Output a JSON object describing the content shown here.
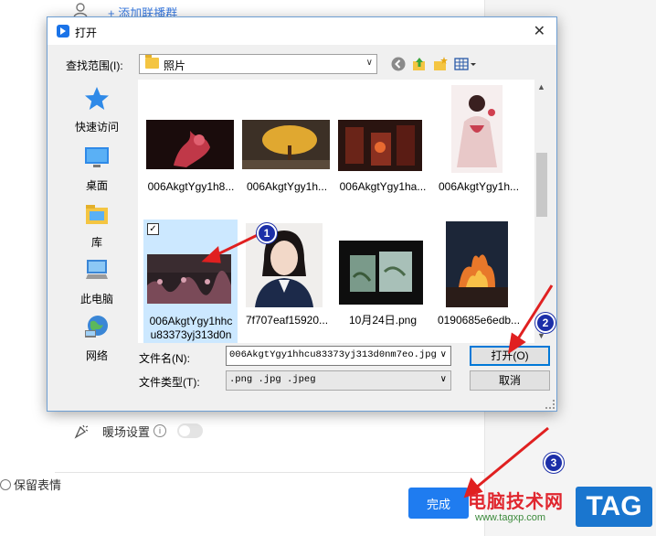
{
  "background": {
    "add_anchor": "+ 添加联播群",
    "warmup_label": "暖场设置",
    "warmup_info": "i",
    "keep_label": "保留表情",
    "done_button": "完成"
  },
  "dialog": {
    "title": "打开",
    "close": "✕",
    "look_in_label": "查找范围(I):",
    "look_in_value": "照片",
    "places": [
      {
        "label": "快速访问",
        "icon": "star-icon"
      },
      {
        "label": "桌面",
        "icon": "desktop-icon"
      },
      {
        "label": "库",
        "icon": "library-icon"
      },
      {
        "label": "此电脑",
        "icon": "computer-icon"
      },
      {
        "label": "网络",
        "icon": "network-icon"
      }
    ],
    "files": [
      {
        "name": "006AkgtYgy1h8...",
        "thumb_color": "#2a1414"
      },
      {
        "name": "006AkgtYgy1h...",
        "thumb_color": "#4a3a1e"
      },
      {
        "name": "006AkgtYgy1ha...",
        "thumb_color": "#3a1a10"
      },
      {
        "name": "006AkgtYgy1h...",
        "thumb_color": "#f2e8e8"
      },
      {
        "name_line1": "006AkgtYgy1hhc",
        "name_line2": "u83373yj313d0n",
        "selected": true,
        "thumb_color": "#2b2226"
      },
      {
        "name": "7f707eaf15920...",
        "thumb_color": "#d8d4d0"
      },
      {
        "name": "10月24日.png",
        "thumb_color": "#111111"
      },
      {
        "name": "0190685e6edb...",
        "thumb_color": "#1a2438"
      }
    ],
    "file_name_label": "文件名(N):",
    "file_name_value": "006AkgtYgy1hhcu83373yj313d0nm7eo.jpg",
    "file_type_label": "文件类型(T):",
    "file_type_value": ".png .jpg .jpeg",
    "open_button": "打开(O)",
    "cancel_button": "取消"
  },
  "annotations": [
    "1",
    "2",
    "3"
  ],
  "watermark": {
    "title": "电脑技术网",
    "url": "www.tagxp.com",
    "tag": "TAG"
  },
  "colors": {
    "accent": "#1f7cf0",
    "selection": "#cce8ff",
    "arrow": "#e02020",
    "badge": "#1c2fa8"
  }
}
